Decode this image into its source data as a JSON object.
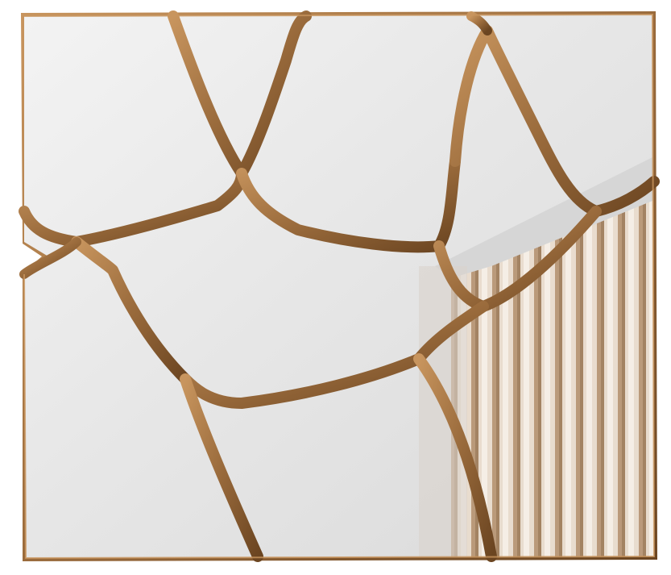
{
  "scene": {
    "subject": "mirror",
    "frame_color": "#9a6b3c",
    "frame_highlight": "#c8955e",
    "frame_shadow": "#6b4521",
    "glass_light": "#f7f7f7",
    "glass_mid": "#e4e4e4",
    "glass_dark": "#cfcfcf",
    "curtain_light": "#e9dccd",
    "curtain_dark": "#a07e5c",
    "background": "#ffffff"
  }
}
